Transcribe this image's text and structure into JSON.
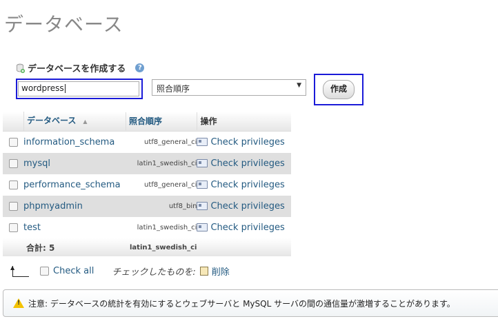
{
  "page": {
    "title": "データベース"
  },
  "create": {
    "heading": "データベースを作成する",
    "db_name_value": "wordpress",
    "collation_value": "照合順序",
    "create_button": "作成"
  },
  "table": {
    "headers": {
      "database": "データベース",
      "collation": "照合順序",
      "action": "操作"
    },
    "rows": [
      {
        "name": "information_schema",
        "collation": "utf8_general_ci",
        "action": "Check privileges"
      },
      {
        "name": "mysql",
        "collation": "latin1_swedish_ci",
        "action": "Check privileges"
      },
      {
        "name": "performance_schema",
        "collation": "utf8_general_ci",
        "action": "Check privileges"
      },
      {
        "name": "phpmyadmin",
        "collation": "utf8_bin",
        "action": "Check privileges"
      },
      {
        "name": "test",
        "collation": "latin1_swedish_ci",
        "action": "Check privileges"
      }
    ],
    "total_label": "合計: 5",
    "total_collation": "latin1_swedish_ci"
  },
  "bulk": {
    "check_all": "Check all",
    "with_selected": "チェックしたものを:",
    "delete": "削除"
  },
  "notice": {
    "text": "注意: データベースの統計を有効にするとウェブサーバと MySQL サーバの間の通信量が激増することがあります。"
  },
  "colors": {
    "link": "#235a81",
    "highlight": "#1a1ad8",
    "row_alt": "#dfdfdf"
  }
}
